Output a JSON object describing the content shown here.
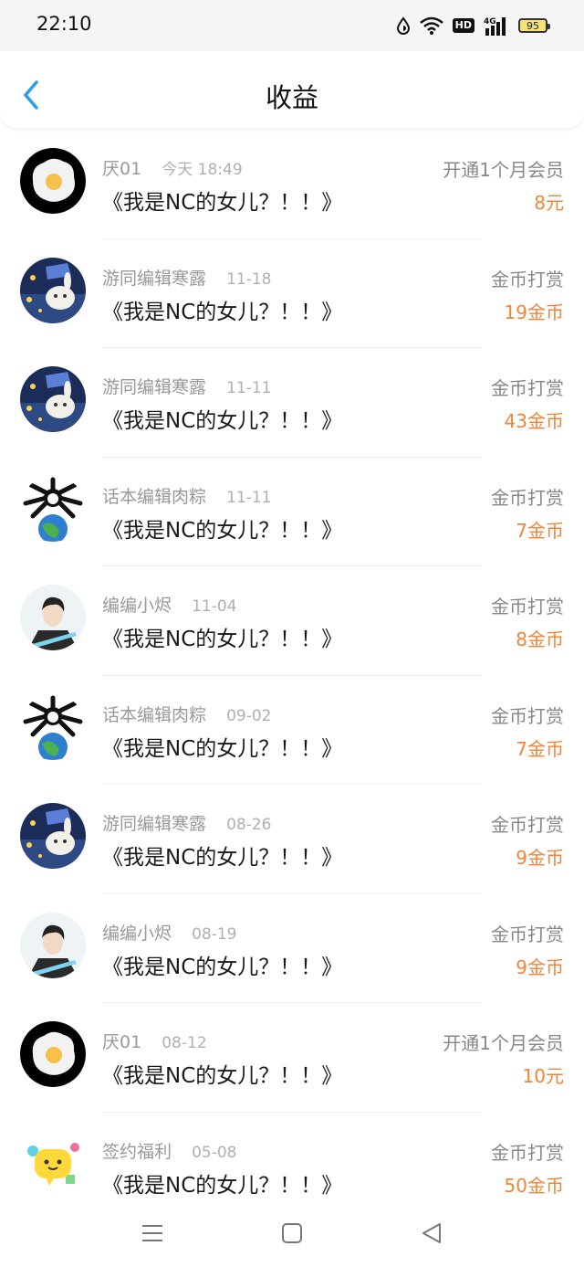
{
  "status_bar": {
    "time": "22:10",
    "battery": "95",
    "icons": [
      "data-saver-icon",
      "wifi-icon",
      "hd-icon",
      "4g-signal-icon",
      "battery-icon"
    ]
  },
  "header": {
    "title": "收益",
    "back_icon": "chevron-left-icon",
    "accent_color": "#2a9df4"
  },
  "colors": {
    "amount": "#f08538",
    "muted_text": "#999999"
  },
  "earnings": [
    {
      "user": "厌01",
      "date": "今天 18:49",
      "work": "《我是NC的女儿？！！》",
      "type": "开通1个月会员",
      "amount": "8元",
      "avatar": "fried-egg-avatar"
    },
    {
      "user": "游同编辑寒露",
      "date": "11-18",
      "work": "《我是NC的女儿？！！》",
      "type": "金币打赏",
      "amount": "19金币",
      "avatar": "night-bunny-avatar"
    },
    {
      "user": "游同编辑寒露",
      "date": "11-11",
      "work": "《我是NC的女儿？！！》",
      "type": "金币打赏",
      "amount": "43金币",
      "avatar": "night-bunny-avatar"
    },
    {
      "user": "话本编辑肉粽",
      "date": "11-11",
      "work": "《我是NC的女儿？！！》",
      "type": "金币打赏",
      "amount": "7金币",
      "avatar": "bone-earth-avatar"
    },
    {
      "user": "编编小烬",
      "date": "11-04",
      "work": "《我是NC的女儿？！！》",
      "type": "金币打赏",
      "amount": "8金币",
      "avatar": "anime-man-avatar"
    },
    {
      "user": "话本编辑肉粽",
      "date": "09-02",
      "work": "《我是NC的女儿？！！》",
      "type": "金币打赏",
      "amount": "7金币",
      "avatar": "bone-earth-avatar"
    },
    {
      "user": "游同编辑寒露",
      "date": "08-26",
      "work": "《我是NC的女儿？！！》",
      "type": "金币打赏",
      "amount": "9金币",
      "avatar": "night-bunny-avatar"
    },
    {
      "user": "编编小烬",
      "date": "08-19",
      "work": "《我是NC的女儿？！！》",
      "type": "金币打赏",
      "amount": "9金币",
      "avatar": "anime-man-avatar"
    },
    {
      "user": "厌01",
      "date": "08-12",
      "work": "《我是NC的女儿？！！》",
      "type": "开通1个月会员",
      "amount": "10元",
      "avatar": "fried-egg-avatar"
    },
    {
      "user": "签约福利",
      "date": "05-08",
      "work": "《我是NC的女儿？！！》",
      "type": "金币打赏",
      "amount": "50金币",
      "avatar": "yellow-chat-avatar"
    }
  ],
  "nav_bar": {
    "icons": [
      "menu-icon",
      "home-square-icon",
      "back-triangle-icon"
    ]
  }
}
